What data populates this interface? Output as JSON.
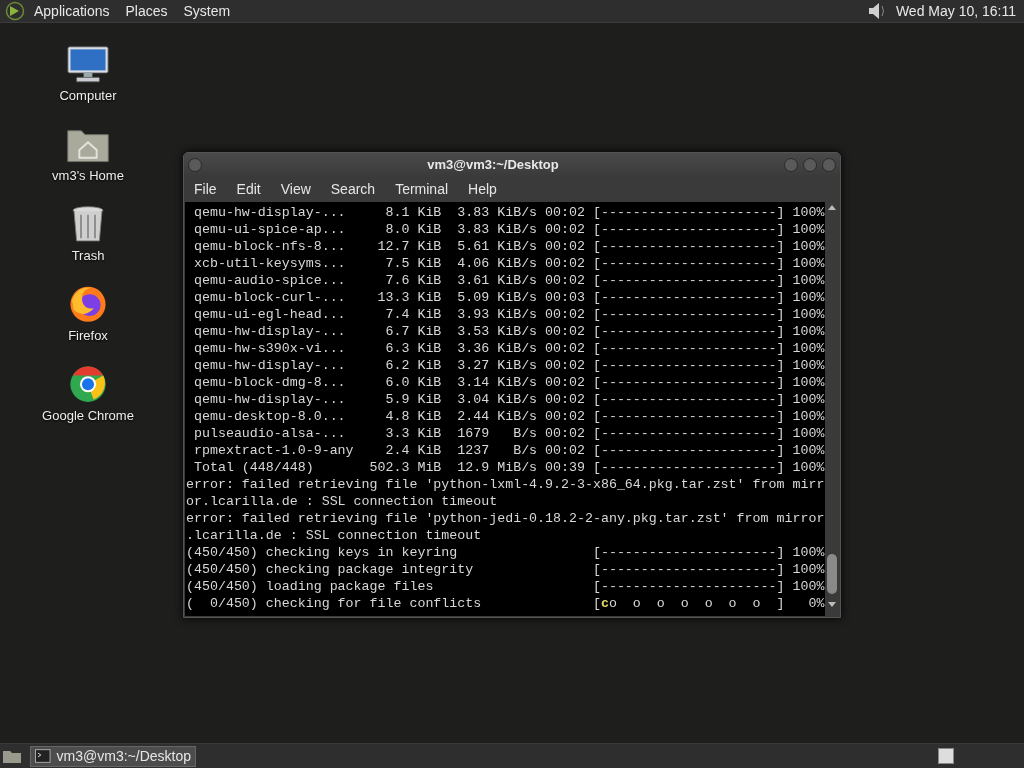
{
  "top_panel": {
    "menus": [
      "Applications",
      "Places",
      "System"
    ],
    "clock": "Wed May 10, 16:11"
  },
  "desktop_icons": [
    {
      "kind": "computer",
      "label": "Computer"
    },
    {
      "kind": "home",
      "label": "vm3's Home"
    },
    {
      "kind": "trash",
      "label": "Trash"
    },
    {
      "kind": "firefox",
      "label": "Firefox"
    },
    {
      "kind": "chrome",
      "label": "Google Chrome"
    }
  ],
  "terminal": {
    "title": "vm3@vm3:~/Desktop",
    "menus": [
      "File",
      "Edit",
      "View",
      "Search",
      "Terminal",
      "Help"
    ],
    "lines": [
      {
        "kind": "plain",
        "text": " qemu-hw-display-...     8.1 KiB  3.83 KiB/s 00:02 [----------------------] 100%"
      },
      {
        "kind": "plain",
        "text": " qemu-ui-spice-ap...     8.0 KiB  3.83 KiB/s 00:02 [----------------------] 100%"
      },
      {
        "kind": "plain",
        "text": " qemu-block-nfs-8...    12.7 KiB  5.61 KiB/s 00:02 [----------------------] 100%"
      },
      {
        "kind": "plain",
        "text": " xcb-util-keysyms...     7.5 KiB  4.06 KiB/s 00:02 [----------------------] 100%"
      },
      {
        "kind": "plain",
        "text": " qemu-audio-spice...     7.6 KiB  3.61 KiB/s 00:02 [----------------------] 100%"
      },
      {
        "kind": "plain",
        "text": " qemu-block-curl-...    13.3 KiB  5.09 KiB/s 00:03 [----------------------] 100%"
      },
      {
        "kind": "plain",
        "text": " qemu-ui-egl-head...     7.4 KiB  3.93 KiB/s 00:02 [----------------------] 100%"
      },
      {
        "kind": "plain",
        "text": " qemu-hw-display-...     6.7 KiB  3.53 KiB/s 00:02 [----------------------] 100%"
      },
      {
        "kind": "plain",
        "text": " qemu-hw-s390x-vi...     6.3 KiB  3.36 KiB/s 00:02 [----------------------] 100%"
      },
      {
        "kind": "plain",
        "text": " qemu-hw-display-...     6.2 KiB  3.27 KiB/s 00:02 [----------------------] 100%"
      },
      {
        "kind": "plain",
        "text": " qemu-block-dmg-8...     6.0 KiB  3.14 KiB/s 00:02 [----------------------] 100%"
      },
      {
        "kind": "plain",
        "text": " qemu-hw-display-...     5.9 KiB  3.04 KiB/s 00:02 [----------------------] 100%"
      },
      {
        "kind": "plain",
        "text": " qemu-desktop-8.0...     4.8 KiB  2.44 KiB/s 00:02 [----------------------] 100%"
      },
      {
        "kind": "plain",
        "text": " pulseaudio-alsa-...     3.3 KiB  1679   B/s 00:02 [----------------------] 100%"
      },
      {
        "kind": "plain",
        "text": " rpmextract-1.0-9-any    2.4 KiB  1237   B/s 00:02 [----------------------] 100%"
      },
      {
        "kind": "plain",
        "text": " Total (448/448)       502.3 MiB  12.9 MiB/s 00:39 [----------------------] 100%"
      },
      {
        "kind": "plain",
        "text": "error: failed retrieving file 'python-lxml-4.9.2-3-x86_64.pkg.tar.zst' from mirr"
      },
      {
        "kind": "plain",
        "text": "or.lcarilla.de : SSL connection timeout"
      },
      {
        "kind": "plain",
        "text": "error: failed retrieving file 'python-jedi-0.18.2-2-any.pkg.tar.zst' from mirror"
      },
      {
        "kind": "plain",
        "text": ".lcarilla.de : SSL connection timeout"
      },
      {
        "kind": "plain",
        "text": "(450/450) checking keys in keyring                 [----------------------] 100%"
      },
      {
        "kind": "plain",
        "text": "(450/450) checking package integrity               [----------------------] 100%"
      },
      {
        "kind": "plain",
        "text": "(450/450) loading package files                    [----------------------] 100%"
      },
      {
        "kind": "pacman",
        "prefix": "(  0/450) checking for file conflicts              [",
        "head": "c",
        "rest": "o  o  o  o  o  o  o  ]   0%"
      }
    ]
  },
  "taskbar": {
    "tasks": [
      {
        "label": "vm3@vm3:~/Desktop",
        "selected": true
      }
    ]
  }
}
